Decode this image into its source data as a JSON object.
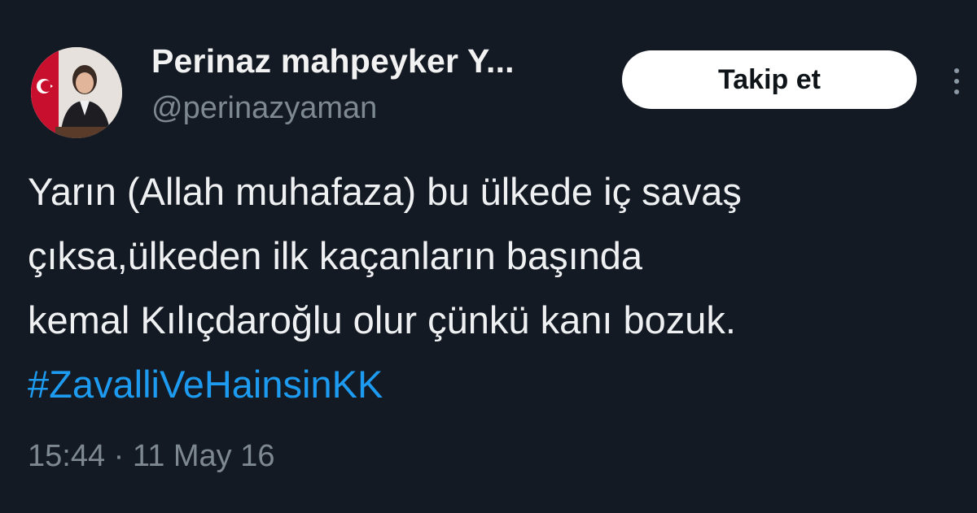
{
  "user": {
    "display_name": "Perinaz mahpeyker Y...",
    "handle": "@perinazyaman"
  },
  "follow_button": {
    "label": "Takip et"
  },
  "more_icon": "more-vertical-icon",
  "tweet": {
    "lines": [
      "Yarın (Allah muhafaza) bu ülkede iç savaş",
      "çıksa,ülkeden ilk kaçanların başında",
      "kemal Kılıçdaroğlu olur çünkü kanı bozuk."
    ],
    "hashtag": "#ZavalliVeHainsinKK",
    "time": "15:44",
    "separator": "·",
    "date": "11 May 16"
  },
  "colors": {
    "background": "#141a24",
    "hashtag": "#1d9bf0",
    "muted": "#7e8891",
    "button_bg": "#ffffff"
  }
}
